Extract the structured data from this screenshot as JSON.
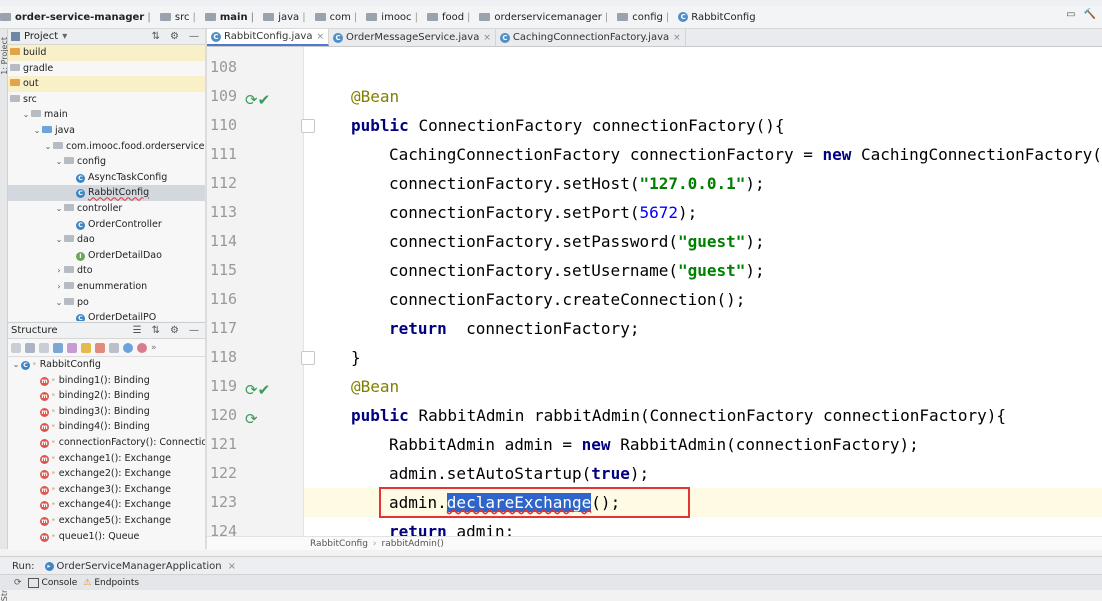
{
  "breadcrumb": {
    "items": [
      {
        "label": "order-service-manager",
        "icon": "folder-icon",
        "bold": true
      },
      {
        "label": "src",
        "icon": "folder-icon"
      },
      {
        "label": "main",
        "icon": "folder-icon",
        "bold": true
      },
      {
        "label": "java",
        "icon": "folder-icon"
      },
      {
        "label": "com",
        "icon": "folder-icon"
      },
      {
        "label": "imooc",
        "icon": "folder-icon"
      },
      {
        "label": "food",
        "icon": "folder-icon"
      },
      {
        "label": "orderservicemanager",
        "icon": "folder-icon"
      },
      {
        "label": "config",
        "icon": "folder-icon"
      },
      {
        "label": "RabbitConfig",
        "icon": "class-icon"
      }
    ]
  },
  "project_panel": {
    "title": "Project",
    "rows": [
      {
        "label": "build",
        "indent": 0,
        "arrow": "",
        "icon": "orange",
        "hl": true
      },
      {
        "label": "gradle",
        "indent": 0,
        "arrow": "",
        "icon": "grey"
      },
      {
        "label": "out",
        "indent": 0,
        "arrow": "",
        "icon": "orange",
        "hl": true
      },
      {
        "label": "src",
        "indent": 0,
        "arrow": "",
        "icon": "grey"
      },
      {
        "label": "main",
        "indent": 1,
        "arrow": "v",
        "icon": "grey"
      },
      {
        "label": "java",
        "indent": 2,
        "arrow": "v",
        "icon": "blue"
      },
      {
        "label": "com.imooc.food.orderservicemana",
        "indent": 3,
        "arrow": "v",
        "icon": "grey"
      },
      {
        "label": "config",
        "indent": 4,
        "arrow": "v",
        "icon": "grey"
      },
      {
        "label": "AsyncTaskConfig",
        "indent": 6,
        "arrow": "",
        "icon": "class"
      },
      {
        "label": "RabbitConfig",
        "indent": 6,
        "arrow": "",
        "icon": "class",
        "sel": true
      },
      {
        "label": "controller",
        "indent": 4,
        "arrow": "v",
        "icon": "grey"
      },
      {
        "label": "OrderController",
        "indent": 6,
        "arrow": "",
        "icon": "class"
      },
      {
        "label": "dao",
        "indent": 4,
        "arrow": "v",
        "icon": "grey"
      },
      {
        "label": "OrderDetailDao",
        "indent": 6,
        "arrow": "",
        "icon": "iface"
      },
      {
        "label": "dto",
        "indent": 4,
        "arrow": ">",
        "icon": "grey"
      },
      {
        "label": "enummeration",
        "indent": 4,
        "arrow": ">",
        "icon": "grey"
      },
      {
        "label": "po",
        "indent": 4,
        "arrow": "v",
        "icon": "grey"
      },
      {
        "label": "OrderDetailPO",
        "indent": 6,
        "arrow": "",
        "icon": "class"
      }
    ]
  },
  "structure_panel": {
    "title": "Structure",
    "root": "RabbitConfig",
    "members": [
      "binding1(): Binding",
      "binding2(): Binding",
      "binding3(): Binding",
      "binding4(): Binding",
      "connectionFactory(): ConnectionF",
      "exchange1(): Exchange",
      "exchange2(): Exchange",
      "exchange3(): Exchange",
      "exchange4(): Exchange",
      "exchange5(): Exchange",
      "queue1(): Queue"
    ]
  },
  "tabs": [
    {
      "label": "RabbitConfig.java",
      "active": true
    },
    {
      "label": "OrderMessageService.java",
      "active": false
    },
    {
      "label": "CachingConnectionFactory.java",
      "active": false
    }
  ],
  "editor": {
    "lines": [
      {
        "num": "108",
        "tokens": []
      },
      {
        "num": "109",
        "tokens": [
          [
            "ann",
            "@Bean"
          ]
        ],
        "indent": 0,
        "marker": true
      },
      {
        "num": "110",
        "tokens": [
          [
            "kw",
            "public "
          ],
          [
            "",
            "ConnectionFactory connectionFactory(){"
          ]
        ],
        "indent": 0,
        "fold": true
      },
      {
        "num": "111",
        "tokens": [
          [
            "",
            "CachingConnectionFactory connectionFactory = "
          ],
          [
            "kw",
            "new "
          ],
          [
            "",
            "CachingConnectionFactory("
          ]
        ],
        "indent": 1
      },
      {
        "num": "112",
        "tokens": [
          [
            "",
            "connectionFactory.setHost("
          ],
          [
            "str",
            "\"127.0.0.1\""
          ],
          [
            "",
            ");"
          ]
        ],
        "indent": 1
      },
      {
        "num": "113",
        "tokens": [
          [
            "",
            "connectionFactory.setPort("
          ],
          [
            "num",
            "5672"
          ],
          [
            "",
            ");"
          ]
        ],
        "indent": 1
      },
      {
        "num": "114",
        "tokens": [
          [
            "",
            "connectionFactory.setPassword("
          ],
          [
            "str",
            "\"guest\""
          ],
          [
            "",
            ");"
          ]
        ],
        "indent": 1
      },
      {
        "num": "115",
        "tokens": [
          [
            "",
            "connectionFactory.setUsername("
          ],
          [
            "str",
            "\"guest\""
          ],
          [
            "",
            ");"
          ]
        ],
        "indent": 1
      },
      {
        "num": "116",
        "tokens": [
          [
            "",
            "connectionFactory.createConnection();"
          ]
        ],
        "indent": 1
      },
      {
        "num": "117",
        "tokens": [
          [
            "kw",
            "return  "
          ],
          [
            "",
            "connectionFactory;"
          ]
        ],
        "indent": 1
      },
      {
        "num": "118",
        "tokens": [
          [
            "",
            "}"
          ]
        ],
        "indent": 0,
        "fold": true
      },
      {
        "num": "119",
        "tokens": [
          [
            "ann",
            "@Bean"
          ]
        ],
        "indent": 0,
        "marker": true
      },
      {
        "num": "120",
        "tokens": [
          [
            "kw",
            "public "
          ],
          [
            "",
            "RabbitAdmin rabbitAdmin(ConnectionFactory connectionFactory){"
          ]
        ],
        "indent": 0,
        "marker2": true
      },
      {
        "num": "121",
        "tokens": [
          [
            "",
            "RabbitAdmin admin = "
          ],
          [
            "kw",
            "new "
          ],
          [
            "",
            "RabbitAdmin(connectionFactory);"
          ]
        ],
        "indent": 1
      },
      {
        "num": "122",
        "tokens": [
          [
            "",
            "admin.setAutoStartup("
          ],
          [
            "kw",
            "true"
          ],
          [
            "",
            ");"
          ]
        ],
        "indent": 1
      },
      {
        "num": "123",
        "tokens": [
          [
            "",
            "admin."
          ],
          [
            "selword",
            "declareExchange"
          ],
          [
            "",
            "();"
          ]
        ],
        "indent": 1,
        "current": true
      },
      {
        "num": "124",
        "tokens": [
          [
            "kw",
            "return "
          ],
          [
            "",
            "admin;"
          ]
        ],
        "indent": 1
      }
    ]
  },
  "editor_breadcrumb": [
    "RabbitConfig",
    "rabbitAdmin()"
  ],
  "run": {
    "label": "Run:",
    "tab": "OrderServiceManagerApplication"
  },
  "bottom_tabs": [
    "Console",
    "Endpoints"
  ]
}
